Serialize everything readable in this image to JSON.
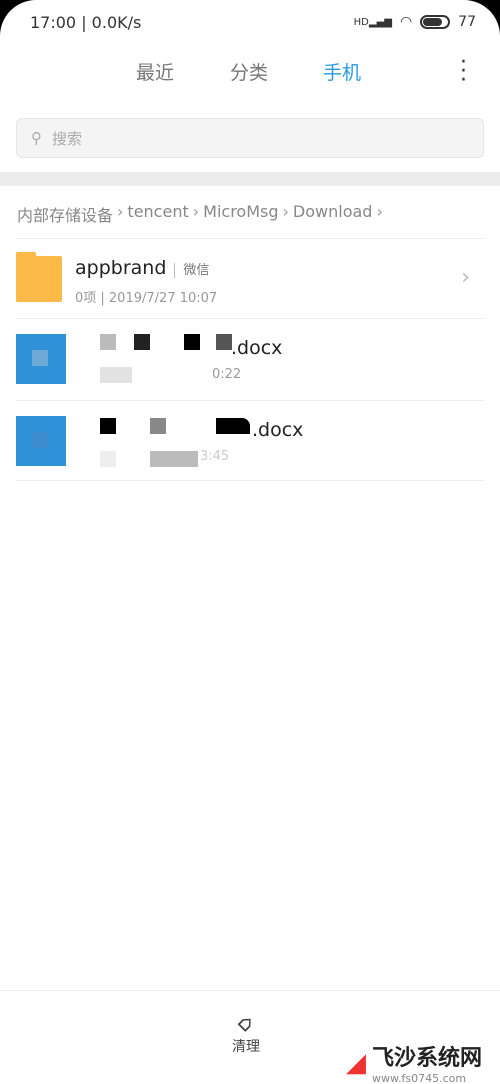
{
  "status": {
    "time": "17:00",
    "speed": "0.0K/s",
    "network": "HD",
    "battery": "77",
    "battery_level": 0.77
  },
  "tabs": [
    {
      "label": "最近"
    },
    {
      "label": "分类"
    },
    {
      "label": "手机",
      "active": true
    }
  ],
  "search": {
    "placeholder": "搜索"
  },
  "breadcrumb": [
    "内部存储设备",
    "tencent",
    "MicroMsg",
    "Download"
  ],
  "files": [
    {
      "name": "appbrand",
      "tag": "微信",
      "meta": "0项 | 2019/7/27 10:07",
      "type": "folder"
    },
    {
      "name": ".docx",
      "meta": "0:22",
      "type": "docx"
    },
    {
      "name": ".docx",
      "meta": "3:45",
      "type": "docx"
    }
  ],
  "bottom": {
    "clean_label": "清理"
  },
  "watermark": {
    "title": "飞沙系统网",
    "url": "www.fs0745.com"
  },
  "colors": {
    "accent": "#2a9be0",
    "folder": "#fbb947",
    "docx": "#2f92d9"
  }
}
